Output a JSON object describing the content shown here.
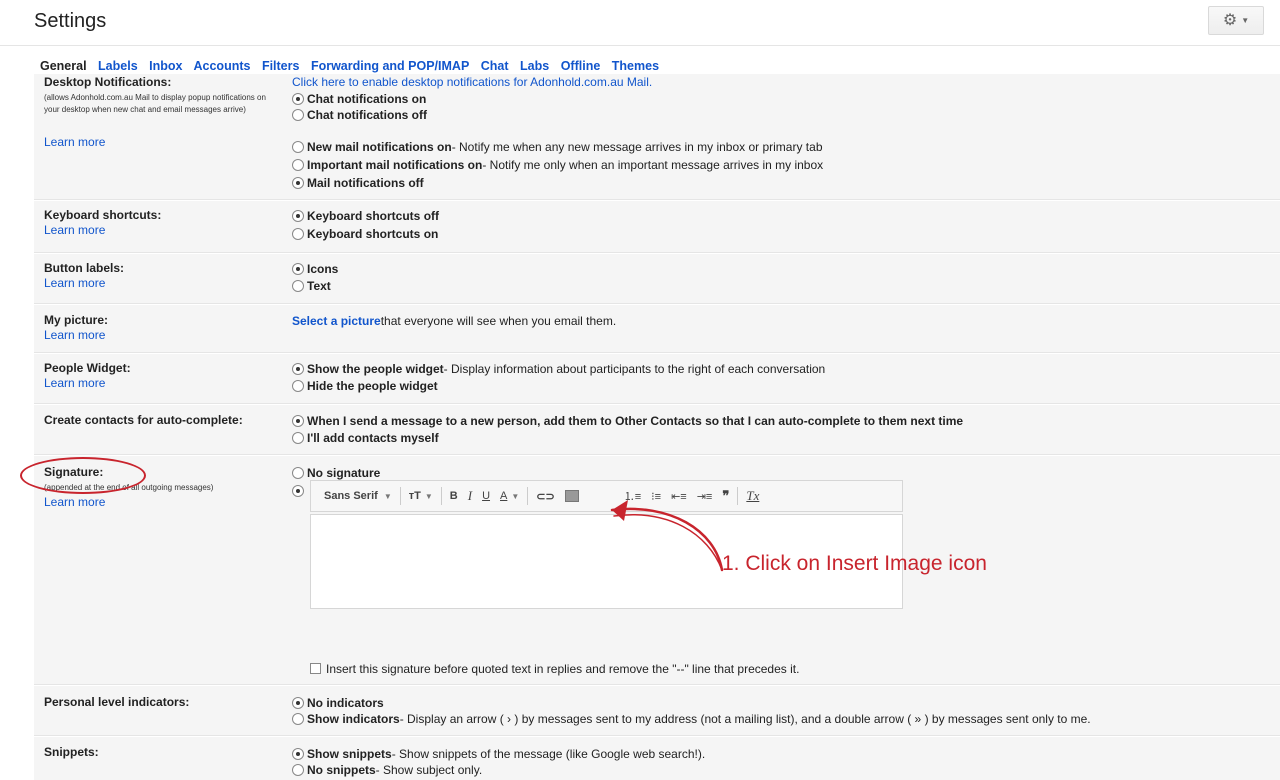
{
  "page": {
    "title": "Settings"
  },
  "tabs": [
    {
      "label": "General",
      "active": true
    },
    {
      "label": "Labels"
    },
    {
      "label": "Inbox"
    },
    {
      "label": "Accounts"
    },
    {
      "label": "Filters"
    },
    {
      "label": "Forwarding and POP/IMAP"
    },
    {
      "label": "Chat"
    },
    {
      "label": "Labs"
    },
    {
      "label": "Offline"
    },
    {
      "label": "Themes"
    }
  ],
  "colors": {
    "link": "#1155cc",
    "annotation": "#c8242d",
    "shaded_row": "#f5f5f5"
  },
  "icons": {
    "gear": "gear-icon",
    "gear_caret": "caret-down-icon",
    "arrow": "curved-arrow-annotation"
  },
  "desktop_notifications": {
    "label": "Desktop Notifications:",
    "sub": "(allows Adonhold.com.au Mail to display popup notifications on your desktop when new chat and email messages arrive)",
    "learn_more": "Learn more",
    "enable_link": "Click here to enable desktop notifications for Adonhold.com.au Mail.",
    "chat_on": "Chat notifications on",
    "chat_off": "Chat notifications off",
    "new_mail": "New mail notifications on",
    "new_mail_desc": " - Notify me when any new message arrives in my inbox or primary tab",
    "important_mail": "Important mail notifications on",
    "important_mail_desc": " - Notify me only when an important message arrives in my inbox",
    "mail_off": "Mail notifications off"
  },
  "keyboard": {
    "label": "Keyboard shortcuts:",
    "learn_more": "Learn more",
    "off": "Keyboard shortcuts off",
    "on": "Keyboard shortcuts on"
  },
  "button_labels": {
    "label": "Button labels:",
    "learn_more": "Learn more",
    "icons": "Icons",
    "text": "Text"
  },
  "my_picture": {
    "label": "My picture:",
    "learn_more": "Learn more",
    "link": "Select a picture",
    "desc": " that everyone will see when you email them."
  },
  "people_widget": {
    "label": "People Widget:",
    "learn_more": "Learn more",
    "show": "Show the people widget",
    "show_desc": " - Display information about participants to the right of each conversation",
    "hide": "Hide the people widget"
  },
  "contacts": {
    "label": "Create contacts for auto-complete:",
    "auto": "When I send a message to a new person, add them to Other Contacts so that I can auto-complete to them next time",
    "manual": "I'll add contacts myself"
  },
  "signature": {
    "label": "Signature:",
    "sub": "(appended at the end of all outgoing messages)",
    "learn_more": "Learn more",
    "none": "No signature",
    "font": "Sans Serif",
    "insert_before": "Insert this signature before quoted text in replies and remove the \"--\" line that precedes it."
  },
  "annotation": {
    "text": "1. Click on Insert Image icon"
  },
  "personal": {
    "label": "Personal level indicators:",
    "none": "No indicators",
    "show": "Show indicators",
    "show_desc": " - Display an arrow ( › ) by messages sent to my address (not a mailing list), and a double arrow ( » ) by messages sent only to me."
  },
  "snippets": {
    "label": "Snippets:",
    "show": "Show snippets",
    "show_desc": " - Show snippets of the message (like Google web search!).",
    "none": "No snippets",
    "none_desc": " - Show subject only."
  }
}
